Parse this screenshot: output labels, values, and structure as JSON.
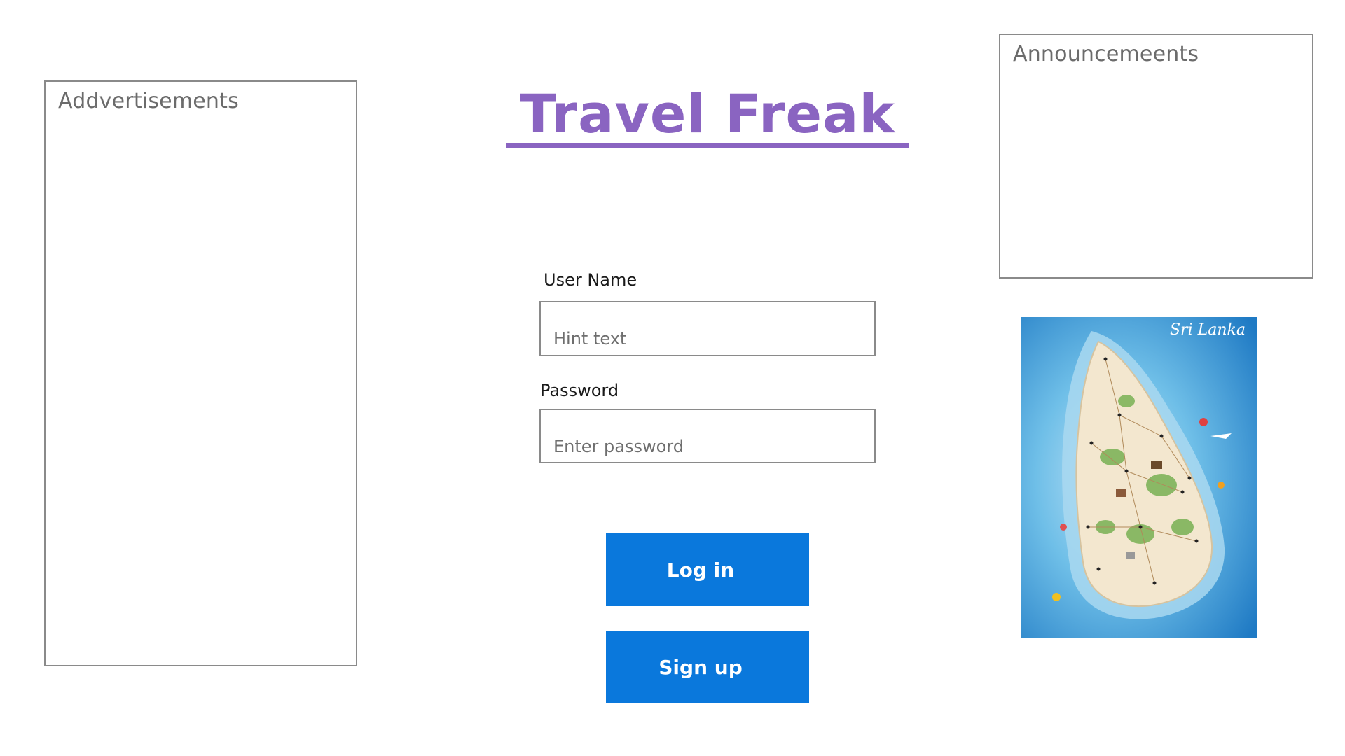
{
  "advertisements": {
    "title": "Addvertisements"
  },
  "announcements": {
    "title": "Announcemeents"
  },
  "header": {
    "title": "Travel Freak",
    "accent_color": "#8a64c1"
  },
  "login_form": {
    "username_label": "User Name",
    "username_placeholder": "Hint text",
    "password_label": "Password",
    "password_placeholder": "Enter password",
    "login_label": "Log in",
    "signup_label": "Sign up",
    "button_color": "#0a78dc"
  },
  "map_image": {
    "caption": "Sri Lanka"
  }
}
